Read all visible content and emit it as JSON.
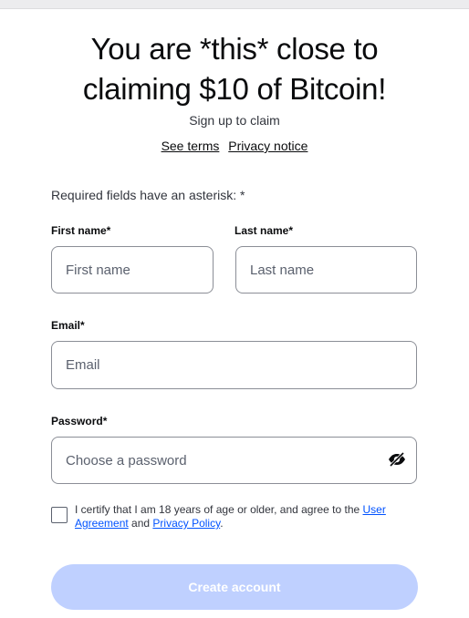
{
  "header": {
    "title_line1": "You are *this* close to",
    "title_line2": "claiming $10 of Bitcoin!",
    "subtitle": "Sign up to claim",
    "terms_link": "See terms",
    "privacy_link": "Privacy notice"
  },
  "form": {
    "required_note": "Required fields have an asterisk: *",
    "first_name": {
      "label": "First name*",
      "placeholder": "First name",
      "value": ""
    },
    "last_name": {
      "label": "Last name*",
      "placeholder": "Last name",
      "value": ""
    },
    "email": {
      "label": "Email*",
      "placeholder": "Email",
      "value": ""
    },
    "password": {
      "label": "Password*",
      "placeholder": "Choose a password",
      "value": "",
      "toggle_icon": "eye-slash-icon"
    },
    "certify": {
      "checked": false,
      "text_before": "I certify that I am 18 years of age or older, and agree to the ",
      "user_agreement_link": "User Agreement",
      "text_middle": " and ",
      "privacy_policy_link": "Privacy Policy",
      "text_after": "."
    },
    "submit_label": "Create account",
    "submit_enabled": false
  },
  "colors": {
    "link_blue": "#0052ff",
    "button_disabled_bg": "#bfd0ff",
    "border": "#8b8e96",
    "text": "#0a0b0d"
  }
}
